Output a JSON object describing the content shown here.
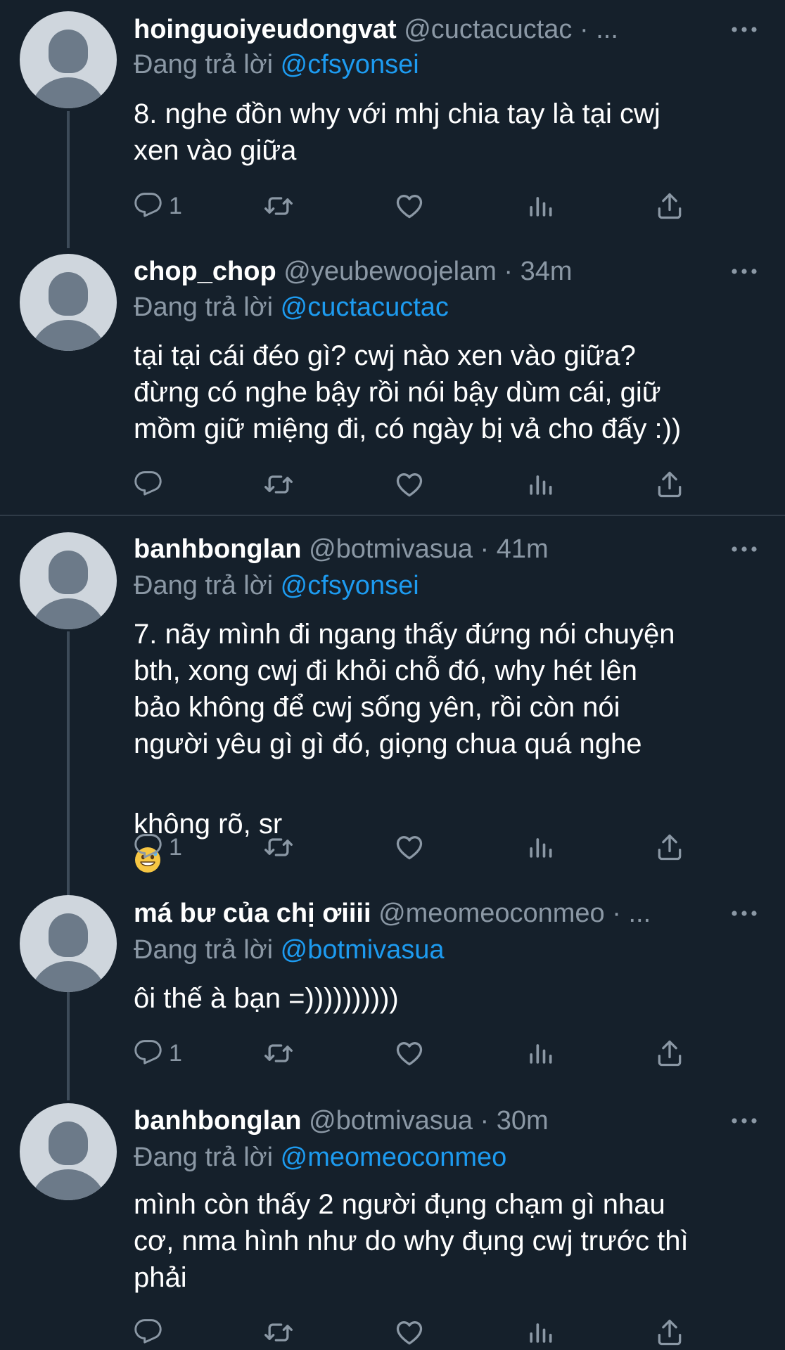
{
  "tweets": [
    {
      "name": "hoinguoiyeudongvat",
      "handle_meta": "@cuctacuctac · ...",
      "reply_prefix": "Đang trả lời",
      "reply_to": "@cfsyonsei",
      "text": "8. nghe đồn why với mhj chia tay là tại cwj\nxen vào giữa",
      "reply_count": "1"
    },
    {
      "name": "chop_chop",
      "handle_meta": "@yeubewoojelam · 34m",
      "reply_prefix": "Đang trả lời",
      "reply_to": "@cuctacuctac",
      "text": "tại tại cái đéo gì? cwj nào xen vào giữa?\nđừng có nghe bậy rồi nói bậy dùm cái, giữ\nmồm giữ miệng đi, có ngày bị vả cho đấy :))",
      "reply_count": ""
    },
    {
      "name": "banhbonglan",
      "handle_meta": "@botmivasua · 41m",
      "reply_prefix": "Đang trả lời",
      "reply_to": "@cfsyonsei",
      "text": "7. nãy mình đi ngang thấy đứng nói chuyện\nbth, xong cwj đi khỏi chỗ đó, why hét lên\nbảo không để cwj sống yên, rồi còn nói\nngười yêu gì gì đó, giọng chua quá nghe",
      "text_last": "không rõ, sr",
      "emoji": "grinning-sweat-emoji",
      "reply_count": "1"
    },
    {
      "name": "má bư của chị ơiiii",
      "handle_meta": "@meomeoconmeo · ...",
      "reply_prefix": "Đang trả lời",
      "reply_to": "@botmivasua",
      "text": "ôi thế à bạn =))))))))))",
      "reply_count": "1"
    },
    {
      "name": "banhbonglan",
      "handle_meta": "@botmivasua · 30m",
      "reply_prefix": "Đang trả lời",
      "reply_to": "@meomeoconmeo",
      "text": "mình còn thấy 2 người đụng chạm gì nhau\ncơ, nma hình như do why đụng cwj trước thì\nphải",
      "reply_count": ""
    }
  ],
  "icons": [
    "reply-icon",
    "retweet-icon",
    "like-icon",
    "views-icon",
    "share-icon",
    "more-options-icon"
  ],
  "colors": {
    "background": "#15202b",
    "text": "#ffffff",
    "secondary": "#8b98a5",
    "accent": "#1d9bf0",
    "divider": "#2f3b47"
  }
}
